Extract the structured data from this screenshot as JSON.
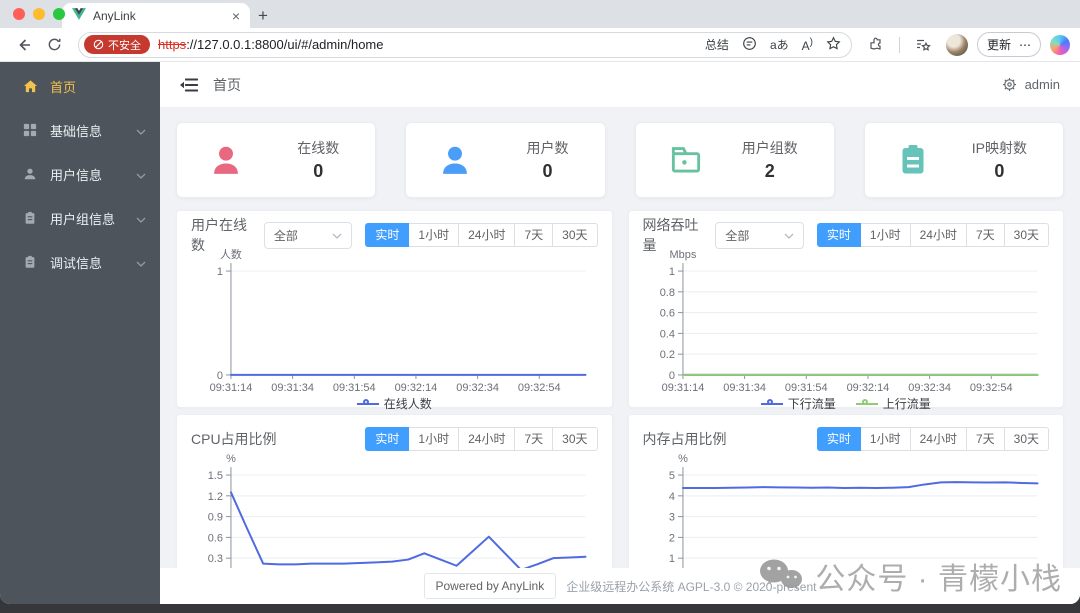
{
  "browser": {
    "tab_title": "AnyLink",
    "tab_close": "×",
    "new_tab": "+",
    "security_badge": "不安全",
    "url_scheme": "https",
    "url_rest": "://127.0.0.1:8800/ui/#/admin/home",
    "toolbar": {
      "summarize": "总结",
      "translate_label": "aあ",
      "read_aloud_label": "A",
      "update_label": "更新",
      "more_label": "⋯"
    }
  },
  "sidebar": {
    "items": [
      {
        "label": "首页",
        "active": true
      },
      {
        "label": "基础信息"
      },
      {
        "label": "用户信息"
      },
      {
        "label": "用户组信息"
      },
      {
        "label": "调试信息"
      }
    ]
  },
  "header": {
    "breadcrumb": "首页",
    "user": "admin"
  },
  "stats": [
    {
      "label": "在线数",
      "value": "0",
      "color": "#e8687f"
    },
    {
      "label": "用户数",
      "value": "0",
      "color": "#4b9ef7"
    },
    {
      "label": "用户组数",
      "value": "2",
      "color": "#66c29f"
    },
    {
      "label": "IP映射数",
      "value": "0",
      "color": "#66c3ba"
    }
  ],
  "time_filters": [
    "实时",
    "1小时",
    "24小时",
    "7天",
    "30天"
  ],
  "colors": {
    "accent": "#409eff",
    "sidebar_active": "#f2c14e",
    "chart_blue": "#4f6be0",
    "chart_green": "#91cc75",
    "badge_red": "#c5392f"
  },
  "chart_data": [
    {
      "type": "line",
      "title": "用户在线数",
      "unit": "人数",
      "select_value": "全部",
      "x": [
        "09:31:14",
        "09:31:34",
        "09:31:54",
        "09:32:14",
        "09:32:34",
        "09:32:54"
      ],
      "ylim": [
        0,
        1
      ],
      "yticks": [
        0,
        1
      ],
      "legend": true,
      "series": [
        {
          "name": "在线人数",
          "color": "#4f6be0",
          "values": [
            0,
            0,
            0,
            0,
            0,
            0,
            0,
            0,
            0,
            0,
            0,
            0,
            0,
            0,
            0,
            0,
            0,
            0,
            0,
            0,
            0,
            0,
            0
          ]
        }
      ]
    },
    {
      "type": "line",
      "title": "网络吞吐量",
      "unit": "Mbps",
      "select_value": "全部",
      "x": [
        "09:31:14",
        "09:31:34",
        "09:31:54",
        "09:32:14",
        "09:32:34",
        "09:32:54"
      ],
      "ylim": [
        0,
        1
      ],
      "yticks": [
        0,
        0.2,
        0.4,
        0.6,
        0.8,
        1
      ],
      "legend": true,
      "series": [
        {
          "name": "下行流量",
          "color": "#4f6be0",
          "values": [
            0,
            0,
            0,
            0,
            0,
            0,
            0,
            0,
            0,
            0,
            0,
            0,
            0,
            0,
            0,
            0,
            0,
            0,
            0,
            0,
            0,
            0,
            0
          ]
        },
        {
          "name": "上行流量",
          "color": "#91cc75",
          "values": [
            0,
            0,
            0,
            0,
            0,
            0,
            0,
            0,
            0,
            0,
            0,
            0,
            0,
            0,
            0,
            0,
            0,
            0,
            0,
            0,
            0,
            0,
            0
          ]
        }
      ]
    },
    {
      "type": "line",
      "title": "CPU占用比例",
      "unit": "%",
      "x": [],
      "ylim": [
        0,
        1.5
      ],
      "yticks": [
        0.3,
        0.6,
        0.9,
        1.2,
        1.5
      ],
      "legend": false,
      "series": [
        {
          "color": "#4f6be0",
          "values": [
            1.25,
            0.73,
            0.22,
            0.21,
            0.21,
            0.22,
            0.22,
            0.22,
            0.23,
            0.24,
            0.25,
            0.28,
            0.37,
            0.28,
            0.19,
            0.4,
            0.61,
            0.37,
            0.13,
            0.21,
            0.3,
            0.31,
            0.32
          ]
        }
      ]
    },
    {
      "type": "line",
      "title": "内存占用比例",
      "unit": "%",
      "x": [],
      "ylim": [
        0,
        5
      ],
      "yticks": [
        1,
        2,
        3,
        4,
        5
      ],
      "legend": false,
      "series": [
        {
          "color": "#4f6be0",
          "values": [
            4.38,
            4.38,
            4.38,
            4.39,
            4.4,
            4.42,
            4.41,
            4.4,
            4.39,
            4.4,
            4.38,
            4.39,
            4.38,
            4.39,
            4.42,
            4.55,
            4.65,
            4.66,
            4.65,
            4.64,
            4.65,
            4.62,
            4.6
          ]
        }
      ]
    }
  ],
  "footer": {
    "powered": "Powered by AnyLink",
    "license": "企业级远程办公系统 AGPL-3.0 © 2020-present"
  },
  "watermark": "公众号 · 青檬小栈"
}
